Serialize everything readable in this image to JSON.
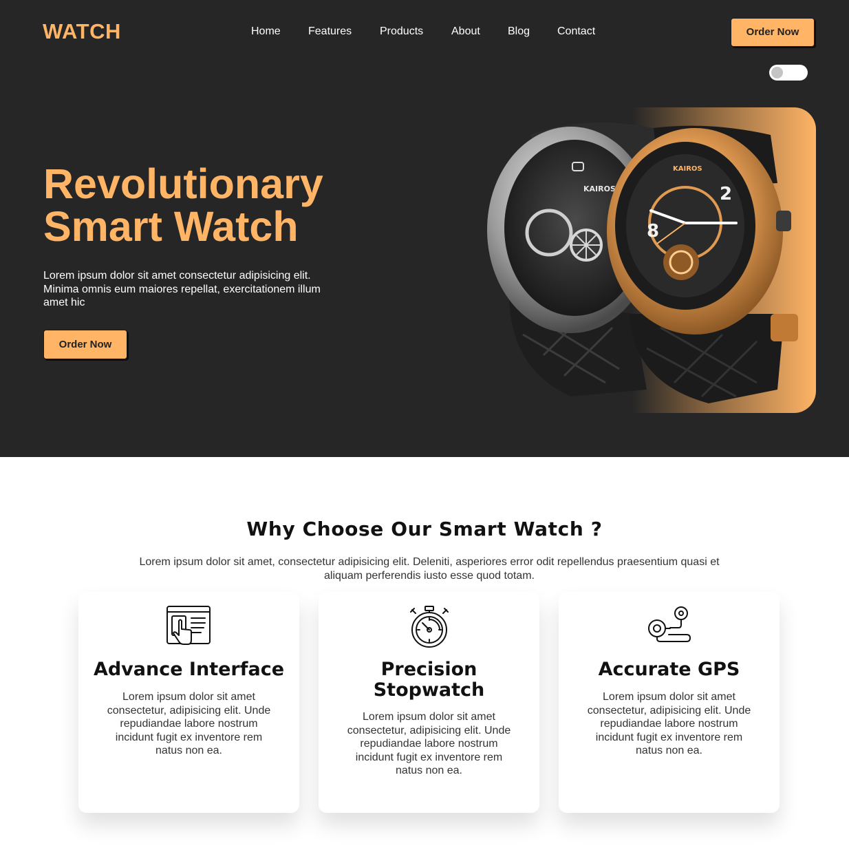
{
  "header": {
    "logo": "WATCH",
    "nav": [
      "Home",
      "Features",
      "Products",
      "About",
      "Blog",
      "Contact"
    ],
    "cta": "Order Now"
  },
  "hero": {
    "title_line1": "Revolutionary",
    "title_line2": "Smart Watch",
    "text": "Lorem ipsum dolor sit amet consectetur adipisicing elit. Minima omnis eum maiores repellat, exercitationem illum amet hic",
    "cta": "Order Now",
    "watch_brand": "KAIROS",
    "theme_toggle_on": false
  },
  "features": {
    "title": "Why Choose Our Smart Watch ?",
    "subtitle": "Lorem ipsum dolor sit amet, consectetur adipisicing elit. Deleniti, asperiores error odit repellendus praesentium quasi et aliquam perferendis iusto esse quod totam.",
    "cards": [
      {
        "icon": "touch-interface-icon",
        "title": "Advance Interface",
        "text": "Lorem ipsum dolor sit amet consectetur, adipisicing elit. Unde repudiandae labore nostrum incidunt fugit ex inventore rem natus non ea."
      },
      {
        "icon": "stopwatch-icon",
        "title": "Precision Stopwatch",
        "text": "Lorem ipsum dolor sit amet consectetur, adipisicing elit. Unde repudiandae labore nostrum incidunt fugit ex inventore rem natus non ea."
      },
      {
        "icon": "gps-route-icon",
        "title": "Accurate GPS",
        "text": "Lorem ipsum dolor sit amet consectetur, adipisicing elit. Unde repudiandae labore nostrum incidunt fugit ex inventore rem natus non ea."
      }
    ]
  },
  "colors": {
    "accent": "#ffb466",
    "hero_bg": "#262626",
    "page_bg": "#ffffff"
  }
}
